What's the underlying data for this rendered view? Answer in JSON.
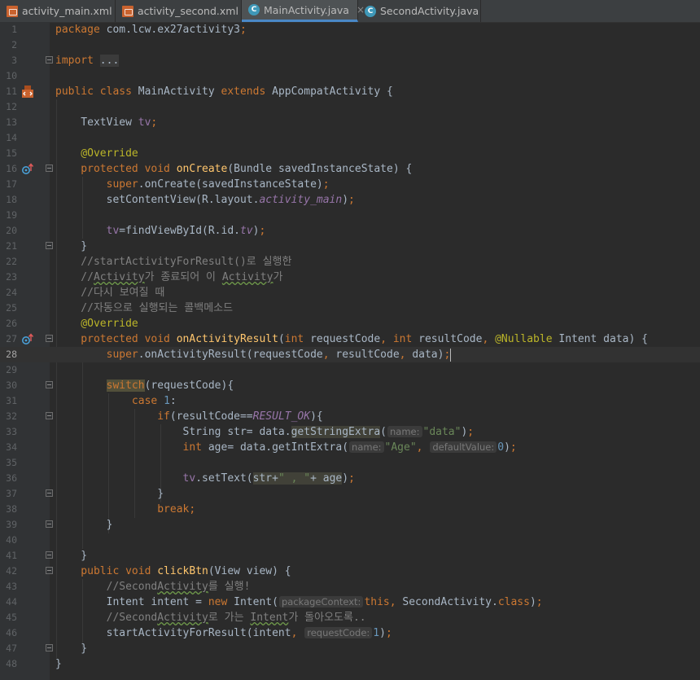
{
  "tabs": [
    {
      "label": "activity_main.xml",
      "icon": "xml-file-icon",
      "active": false
    },
    {
      "label": "activity_second.xml",
      "icon": "xml-file-icon",
      "active": false
    },
    {
      "label": "MainActivity.java",
      "icon": "java-class-icon",
      "active": true
    },
    {
      "label": "SecondActivity.java",
      "icon": "java-class-icon",
      "active": false
    }
  ],
  "tab_close_glyph": "×",
  "class_icon_letter": "C",
  "current_line": 28,
  "lines": [
    {
      "n": "1",
      "segs": [
        [
          "kw",
          "package "
        ],
        [
          "",
          "com.lcw.ex27activity3"
        ],
        [
          "kw",
          ";"
        ]
      ]
    },
    {
      "n": "2",
      "segs": []
    },
    {
      "n": "3",
      "segs": [
        [
          "kw",
          "import "
        ],
        [
          "dots",
          "..."
        ]
      ]
    },
    {
      "n": "10",
      "segs": []
    },
    {
      "n": "11",
      "segs": [
        [
          "kw",
          "public class "
        ],
        [
          "",
          "MainActivity "
        ],
        [
          "kw",
          "extends "
        ],
        [
          "",
          "AppCompatActivity {"
        ]
      ]
    },
    {
      "n": "12",
      "segs": []
    },
    {
      "n": "13",
      "segs": [
        [
          "",
          "    TextView "
        ],
        [
          "fld",
          "tv"
        ],
        [
          "kw",
          ";"
        ]
      ]
    },
    {
      "n": "14",
      "segs": []
    },
    {
      "n": "15",
      "segs": [
        [
          "ann",
          "    @Override"
        ]
      ]
    },
    {
      "n": "16",
      "segs": [
        [
          "kw",
          "    protected void "
        ],
        [
          "fn",
          "onCreate"
        ],
        [
          "",
          "(Bundle savedInstanceState) {"
        ]
      ]
    },
    {
      "n": "17",
      "segs": [
        [
          "kw",
          "        super"
        ],
        [
          "",
          ".onCreate(savedInstanceState)"
        ],
        [
          "kw",
          ";"
        ]
      ]
    },
    {
      "n": "18",
      "segs": [
        [
          "",
          "        setContentView(R.layout."
        ],
        [
          "ital",
          "activity_main"
        ],
        [
          "",
          ")"
        ],
        [
          "kw",
          ";"
        ]
      ]
    },
    {
      "n": "19",
      "segs": []
    },
    {
      "n": "20",
      "segs": [
        [
          "fld",
          "        tv"
        ],
        [
          "",
          "=findViewById(R.id."
        ],
        [
          "ital",
          "tv"
        ],
        [
          "",
          ")"
        ],
        [
          "kw",
          ";"
        ]
      ]
    },
    {
      "n": "21",
      "segs": [
        [
          "",
          "    }"
        ]
      ]
    },
    {
      "n": "22",
      "segs": [
        [
          "cm",
          "    //startActivityForResult()로 실행한"
        ]
      ]
    },
    {
      "n": "23",
      "segs": [
        [
          "cm",
          "    //"
        ],
        [
          "cmu",
          "Activity"
        ],
        [
          "cm",
          "가 종료되어 이 "
        ],
        [
          "cmu",
          "Activity"
        ],
        [
          "cm",
          "가"
        ]
      ]
    },
    {
      "n": "24",
      "segs": [
        [
          "cm",
          "    //다시 보여질 때"
        ]
      ]
    },
    {
      "n": "25",
      "segs": [
        [
          "cm",
          "    //자동으로 실행되는 콜백메소드"
        ]
      ]
    },
    {
      "n": "26",
      "segs": [
        [
          "ann",
          "    @Override"
        ]
      ]
    },
    {
      "n": "27",
      "segs": [
        [
          "kw",
          "    protected void "
        ],
        [
          "fn",
          "onActivityResult"
        ],
        [
          "",
          "("
        ],
        [
          "kw",
          "int "
        ],
        [
          "",
          "requestCode"
        ],
        [
          "kw",
          ", int "
        ],
        [
          "",
          "resultCode"
        ],
        [
          "kw",
          ", "
        ],
        [
          "ann",
          "@Nullable "
        ],
        [
          "",
          "Intent data) {"
        ]
      ]
    },
    {
      "n": "28",
      "segs": [
        [
          "kw",
          "        super"
        ],
        [
          "",
          ".onActivityResult(requestCode"
        ],
        [
          "kw",
          ", "
        ],
        [
          "",
          "resultCode"
        ],
        [
          "kw",
          ", "
        ],
        [
          "",
          "data)"
        ],
        [
          "kw",
          ";"
        ],
        [
          "caret",
          ""
        ]
      ]
    },
    {
      "n": "29",
      "segs": []
    },
    {
      "n": "30",
      "segs": [
        [
          "",
          "        "
        ],
        [
          "sw",
          "switch"
        ],
        [
          "",
          "(requestCode){"
        ]
      ]
    },
    {
      "n": "31",
      "segs": [
        [
          "kw",
          "            case "
        ],
        [
          "num",
          "1"
        ],
        [
          "",
          ":"
        ]
      ]
    },
    {
      "n": "32",
      "segs": [
        [
          "kw",
          "                if"
        ],
        [
          "",
          "(resultCode=="
        ],
        [
          "ital",
          "RESULT_OK"
        ],
        [
          "",
          "){"
        ]
      ]
    },
    {
      "n": "33",
      "segs": [
        [
          "",
          "                    String str= data."
        ],
        [
          "hl",
          "getStringExtra"
        ],
        [
          "",
          "("
        ],
        [
          "hint",
          "name:"
        ],
        [
          "str",
          "\"data\""
        ],
        [
          "",
          ")"
        ],
        [
          "kw",
          ";"
        ]
      ]
    },
    {
      "n": "34",
      "segs": [
        [
          "kw",
          "                    int "
        ],
        [
          "",
          "age= data.getIntExtra("
        ],
        [
          "hint",
          "name:"
        ],
        [
          "str",
          "\"Age\""
        ],
        [
          "kw",
          ", "
        ],
        [
          "hint",
          "defaultValue:"
        ],
        [
          "num",
          "0"
        ],
        [
          "",
          ")"
        ],
        [
          "kw",
          ";"
        ]
      ]
    },
    {
      "n": "35",
      "segs": []
    },
    {
      "n": "36",
      "segs": [
        [
          "fld",
          "                    tv"
        ],
        [
          "",
          ".setText("
        ],
        [
          "hls",
          "str+"
        ],
        [
          "strh",
          "\" , \""
        ],
        [
          "hls",
          "+ age"
        ],
        [
          "",
          ")"
        ],
        [
          "kw",
          ";"
        ]
      ]
    },
    {
      "n": "37",
      "segs": [
        [
          "",
          "                }"
        ]
      ]
    },
    {
      "n": "38",
      "segs": [
        [
          "kw",
          "                break;"
        ]
      ]
    },
    {
      "n": "39",
      "segs": [
        [
          "",
          "        }"
        ]
      ]
    },
    {
      "n": "40",
      "segs": []
    },
    {
      "n": "41",
      "segs": [
        [
          "",
          "    }"
        ]
      ]
    },
    {
      "n": "42",
      "segs": [
        [
          "kw",
          "    public void "
        ],
        [
          "fn",
          "clickBtn"
        ],
        [
          "",
          "(View view) {"
        ]
      ]
    },
    {
      "n": "43",
      "segs": [
        [
          "cm",
          "        //Second"
        ],
        [
          "cmu",
          "Activity"
        ],
        [
          "cm",
          "를 실행!"
        ]
      ]
    },
    {
      "n": "44",
      "segs": [
        [
          "",
          "        Intent intent = "
        ],
        [
          "kw",
          "new "
        ],
        [
          "",
          "Intent("
        ],
        [
          "hint",
          "packageContext:"
        ],
        [
          "kw",
          "this, "
        ],
        [
          "",
          "SecondActivity."
        ],
        [
          "kw",
          "class"
        ],
        [
          "",
          ")"
        ],
        [
          "kw",
          ";"
        ]
      ]
    },
    {
      "n": "45",
      "segs": [
        [
          "cm",
          "        //Second"
        ],
        [
          "cmu",
          "Activity"
        ],
        [
          "cm",
          "로 가는 "
        ],
        [
          "cmu",
          "Intent"
        ],
        [
          "cm",
          "가 돌아오도록.."
        ]
      ]
    },
    {
      "n": "46",
      "segs": [
        [
          "",
          "        startActivityForResult(intent"
        ],
        [
          "kw",
          ", "
        ],
        [
          "hint",
          "requestCode:"
        ],
        [
          "num",
          "1"
        ],
        [
          "",
          ")"
        ],
        [
          "kw",
          ";"
        ]
      ]
    },
    {
      "n": "47",
      "segs": [
        [
          "",
          "    }"
        ]
      ]
    },
    {
      "n": "48",
      "segs": [
        [
          "",
          "}"
        ]
      ]
    }
  ]
}
